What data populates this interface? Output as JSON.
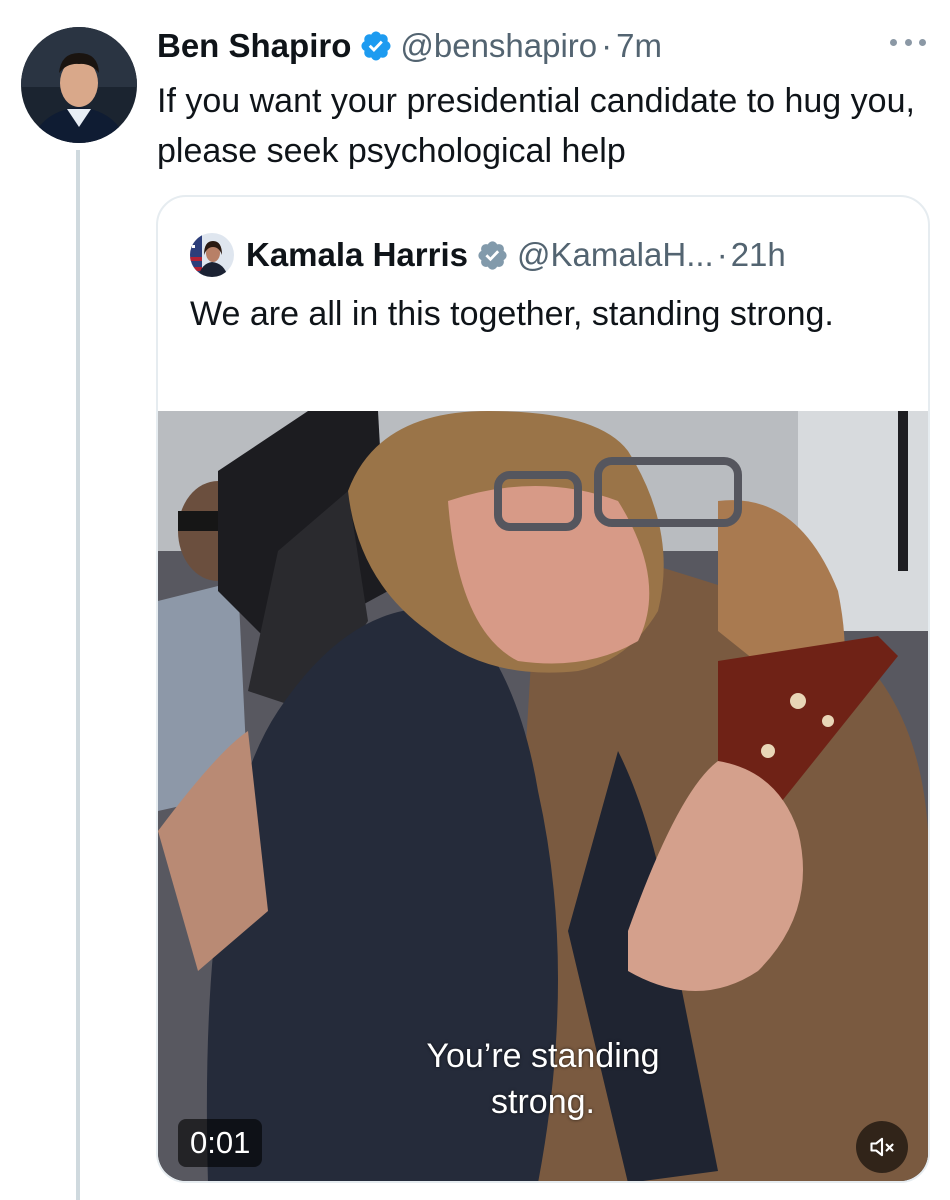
{
  "tweet": {
    "author_name": "Ben Shapiro",
    "author_handle": "@benshapiro",
    "separator": "·",
    "time": "7m",
    "text": "If you want your presidential candidate to hug you, please seek psychological help",
    "more_icon": "more-horizontal-icon"
  },
  "quoted_tweet": {
    "author_name": "Kamala Harris",
    "author_handle": "@KamalaH...",
    "separator": "·",
    "time": "21h",
    "text": "We are all in this together, standing strong.",
    "video": {
      "caption_line1": "You’re standing",
      "caption_line2": "strong.",
      "duration": "0:01",
      "mute_icon": "volume-muted-icon"
    }
  },
  "colors": {
    "verified_blue": "#1d9bf0",
    "secondary_text": "#536471",
    "border": "#e6ecf0"
  }
}
